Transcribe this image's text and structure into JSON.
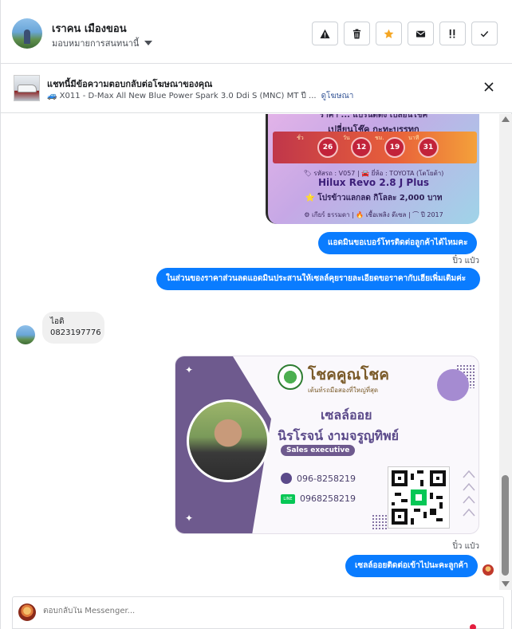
{
  "header": {
    "contact_name": "เราคน เมืองขอน",
    "assign_label": "มอบหมายการสนทนานี้",
    "actions": [
      {
        "icon": "warning-icon",
        "title": "spam"
      },
      {
        "icon": "trash-icon",
        "title": "delete"
      },
      {
        "icon": "star-icon",
        "title": "star",
        "color": "#f5a623"
      },
      {
        "icon": "envelope-icon",
        "title": "mark-unread"
      },
      {
        "icon": "follow-up-icon",
        "title": "follow-up"
      },
      {
        "icon": "check-icon",
        "title": "done"
      }
    ]
  },
  "ad_banner": {
    "title": "แชทนี้มีข้อความตอบกลับต่อโฆษณาของคุณ",
    "ad_text": "🚙 X011 - D-Max All New Blue Power Spark 3.0 Ddi S (MNC) MT ปี ...",
    "view_ad_link": "ดูโฆษณา"
  },
  "messages": {
    "car_card": {
      "line1": "ราคา ... แบรนด์ดัง เปลี่ยนโช๊ค",
      "line2": "เปลี่ยนโช๊ค กะทะบรรทุก",
      "countdown": [
        {
          "label": "ชั่ว",
          "value": "26"
        },
        {
          "label": "วัน",
          "value": "12"
        },
        {
          "label": "ชม.",
          "value": "19"
        },
        {
          "label": "นาที",
          "value": "31"
        }
      ],
      "meta": "🏷 รหัสรถ : V057 | 🚘 ยี่ห้อ : TOYOTA (โตโยต้า)",
      "model": "Hilux Revo 2.8 J Plus",
      "promo": "⭐ โปรข้าวแลกลด กิโลละ 2,000 บาท",
      "footer": "⚙ เกียร์ ธรรมดา | 🔥 เชื้อเพลิง ดีเซล | ⌒ ปี 2017"
    },
    "out_1": "แอดมินขอเบอร์โทรติดต่อลูกค้าได้ไหมคะ",
    "sender_1": "ปิ๋ว แป๋ว",
    "out_2": "ในส่วนของราคาส่วนลดแอดมินประสานให้เซลล์คุยรายละเอียดขอราคากับเฮียเพิ่มเติมค่ะ",
    "in_1_line1": "ไอดิ",
    "in_1_line2": "0823197776",
    "business_card": {
      "brand": "โชคคูณโชค",
      "tagline": "เต้นท์รถมือสองที่ใหญ่ที่สุด",
      "title": "เซลล์ออย",
      "name": "นิรโรจน์  งามจรูญทิพย์",
      "role": "Sales executive",
      "phone": "096-8258219",
      "line_id": "0968258219",
      "line_badge": "LINE"
    },
    "sender_2": "ปิ๋ว แป๋ว",
    "out_3": "เซลล์ออยติดต่อเข้าไปนะคะลูกค้า"
  },
  "composer": {
    "placeholder": "ตอบกลับใน Messenger..."
  }
}
